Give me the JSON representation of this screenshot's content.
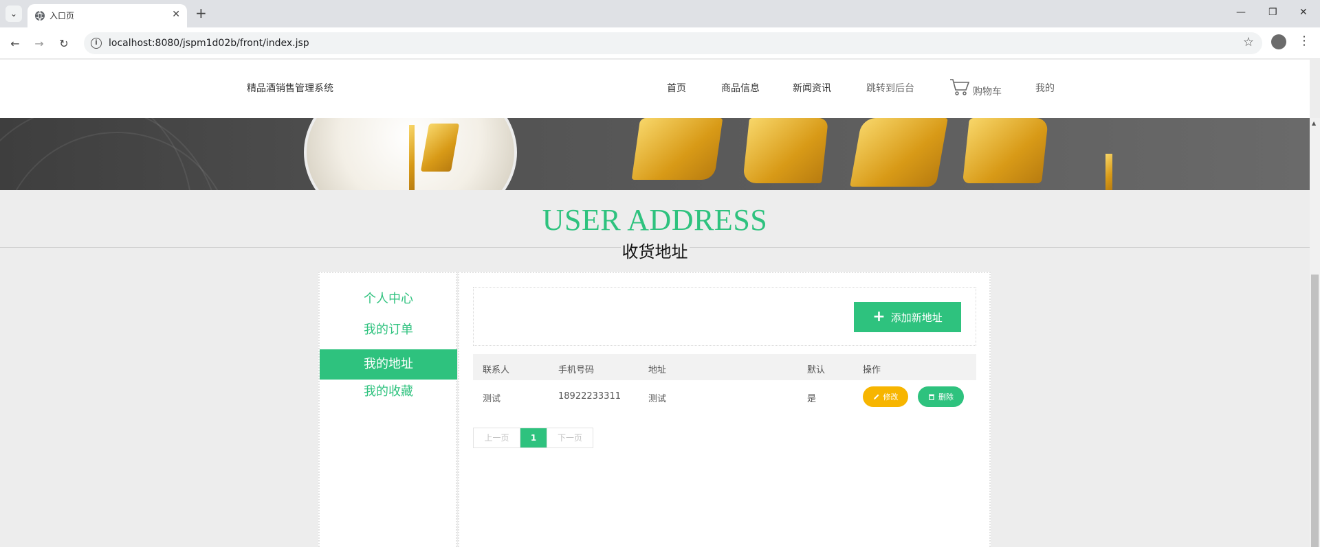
{
  "browser": {
    "tab_title": "入口页",
    "url": "localhost:8080/jspm1d02b/front/index.jsp",
    "icons": [
      "tab-search-icon",
      "globe-icon",
      "close-icon",
      "plus-icon",
      "minimize-icon",
      "restore-icon",
      "back-icon",
      "forward-icon",
      "reload-icon",
      "info-icon",
      "star-icon",
      "profile-icon",
      "menu-icon"
    ]
  },
  "site": {
    "logo": "精品酒销售管理系统",
    "nav": {
      "home": "首页",
      "products": "商品信息",
      "news": "新闻资讯",
      "admin": "跳转到后台",
      "cart": "购物车",
      "mine": "我的"
    }
  },
  "section": {
    "title_en": "USER ADDRESS",
    "title_cn": "收货地址"
  },
  "sidebar": {
    "items": [
      {
        "label": "个人中心",
        "active": false
      },
      {
        "label": "我的订单",
        "active": false
      },
      {
        "label": "我的地址",
        "active": true
      },
      {
        "label": "我的收藏",
        "active": false
      }
    ]
  },
  "address": {
    "add_label": "添加新地址",
    "columns": [
      "联系人",
      "手机号码",
      "地址",
      "默认",
      "操作"
    ],
    "rows": [
      {
        "contact": "测试",
        "phone": "18922233311",
        "address": "测试",
        "default": "是"
      }
    ],
    "edit_label": "修改",
    "delete_label": "删除"
  },
  "pagination": {
    "prev": "上一页",
    "current": "1",
    "next": "下一页"
  },
  "colors": {
    "accent": "#2ec27e",
    "warning": "#f7b500"
  }
}
